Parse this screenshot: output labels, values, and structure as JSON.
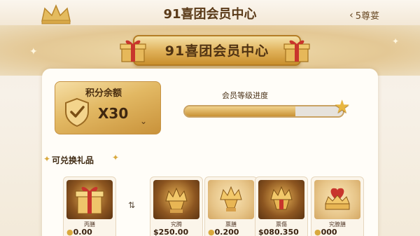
{
  "header": {
    "title": "91喜团会员中心",
    "back_label": "5尊荽"
  },
  "banner": {
    "title": "91喜团会员中心"
  },
  "points": {
    "label": "积分余额",
    "value": "X30"
  },
  "level": {
    "label": "会员等级进度",
    "progress": 0.7
  },
  "gifts_section": {
    "title": "可兑换礼品",
    "items": [
      {
        "name": "丙膳",
        "price": "0.00"
      },
      {
        "name": "究腾",
        "price": "$250.00"
      },
      {
        "name": "票膳",
        "price": "0.200"
      },
      {
        "name": "票傷",
        "price": "$080.350"
      },
      {
        "name": "究膫膳",
        "price": "000"
      }
    ]
  },
  "colors": {
    "gold": "#c9923a",
    "accent": "#e8b640",
    "text": "#4a2e10"
  },
  "icons": [
    "crown-icon",
    "chevron-left-icon",
    "gift-icon",
    "shield-check-icon",
    "chevron-down-icon",
    "star-icon",
    "sparkle-icon",
    "swap-icon",
    "coin-icon"
  ]
}
